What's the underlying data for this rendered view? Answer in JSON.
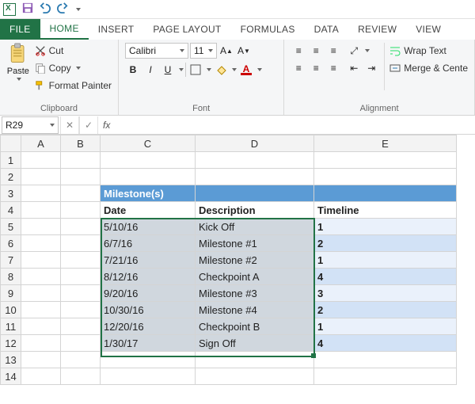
{
  "qat": {
    "save": "save",
    "undo": "undo",
    "redo": "redo"
  },
  "tabs": {
    "file": "FILE",
    "home": "HOME",
    "insert": "INSERT",
    "pagelayout": "PAGE LAYOUT",
    "formulas": "FORMULAS",
    "data": "DATA",
    "review": "REVIEW",
    "view": "VIEW",
    "active": "home"
  },
  "ribbon": {
    "clipboard": {
      "paste": "Paste",
      "cut": "Cut",
      "copy": "Copy",
      "formatpainter": "Format Painter",
      "label": "Clipboard"
    },
    "font": {
      "name": "Calibri",
      "size": "11",
      "bold": "B",
      "italic": "I",
      "underline": "U",
      "label": "Font"
    },
    "alignment": {
      "wrap": "Wrap Text",
      "merge": "Merge & Cente",
      "label": "Alignment"
    }
  },
  "formula_bar": {
    "namebox": "R29",
    "fx": "fx",
    "value": ""
  },
  "columns": [
    "A",
    "B",
    "C",
    "D",
    "E"
  ],
  "rows": [
    "1",
    "2",
    "3",
    "4",
    "5",
    "6",
    "7",
    "8",
    "9",
    "10",
    "11",
    "12",
    "13",
    "14"
  ],
  "cells": {
    "C3": "Milestone(s)",
    "C4": "Date",
    "D4": "Description",
    "E4": "Timeline",
    "C5": "5/10/16",
    "D5": "Kick Off",
    "E5": "1",
    "C6": "6/7/16",
    "D6": "Milestone #1",
    "E6": "2",
    "C7": "7/21/16",
    "D7": "Milestone #2",
    "E7": "1",
    "C8": "8/12/16",
    "D8": "Checkpoint A",
    "E8": "4",
    "C9": "9/20/16",
    "D9": "Milestone #3",
    "E9": "3",
    "C10": "10/30/16",
    "D10": "Milestone #4",
    "E10": "2",
    "C11": "12/20/16",
    "D11": "Checkpoint B",
    "E11": "1",
    "C12": "1/30/17",
    "D12": "Sign Off",
    "E12": "4"
  },
  "selection": {
    "ref": "C5:D12"
  },
  "chart_data": {
    "type": "table",
    "title": "Milestone(s)",
    "columns": [
      "Date",
      "Description",
      "Timeline"
    ],
    "rows": [
      [
        "5/10/16",
        "Kick Off",
        1
      ],
      [
        "6/7/16",
        "Milestone #1",
        2
      ],
      [
        "7/21/16",
        "Milestone #2",
        1
      ],
      [
        "8/12/16",
        "Checkpoint A",
        4
      ],
      [
        "9/20/16",
        "Milestone #3",
        3
      ],
      [
        "10/30/16",
        "Milestone #4",
        2
      ],
      [
        "12/20/16",
        "Checkpoint B",
        1
      ],
      [
        "1/30/17",
        "Sign Off",
        4
      ]
    ]
  }
}
